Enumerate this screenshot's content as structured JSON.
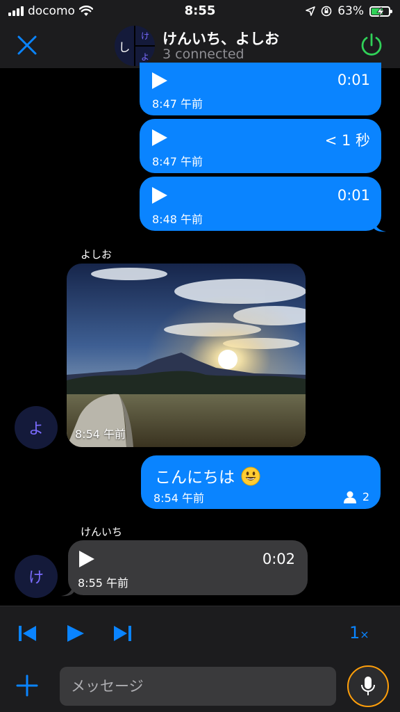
{
  "status_bar": {
    "carrier": "docomo",
    "time": "8:55",
    "battery": "63%",
    "battery_level": 0.63
  },
  "header": {
    "title": "けんいち、よしお",
    "subtitle": "3 connected",
    "avatar_initials": [
      "し",
      "け",
      "よ"
    ],
    "close_icon": "close-icon",
    "power_icon": "power-icon",
    "power_color": "#30d158"
  },
  "messages": [
    {
      "type": "voice",
      "direction": "outgoing",
      "duration": "0:01",
      "time": "8:47 午前"
    },
    {
      "type": "voice",
      "direction": "outgoing",
      "duration": "< 1 秒",
      "time": "8:47 午前"
    },
    {
      "type": "voice",
      "direction": "outgoing",
      "duration": "0:01",
      "time": "8:48 午前"
    },
    {
      "type": "photo",
      "direction": "incoming",
      "sender": "よしお",
      "avatar": "よ",
      "time": "8:54 午前"
    },
    {
      "type": "text",
      "direction": "outgoing",
      "text": "こんにちは",
      "emoji": "smiley-emoji-icon",
      "time": "8:54 午前",
      "readers": "2"
    },
    {
      "type": "voice",
      "direction": "incoming",
      "sender": "けんいち",
      "avatar": "け",
      "duration": "0:02",
      "time": "8:55 午前"
    }
  ],
  "player": {
    "speed": "1",
    "speed_suffix": "×",
    "icons": [
      "skip-previous-icon",
      "play-icon",
      "skip-next-icon"
    ]
  },
  "compose": {
    "placeholder": "メッセージ",
    "add_icon": "plus-icon",
    "mic_icon": "microphone-icon"
  },
  "colors": {
    "accent": "#0a84ff",
    "incoming_bubble": "#3a3a3c",
    "avatar_text": "#7b6cff",
    "mic_ring": "#ff9f0a"
  }
}
